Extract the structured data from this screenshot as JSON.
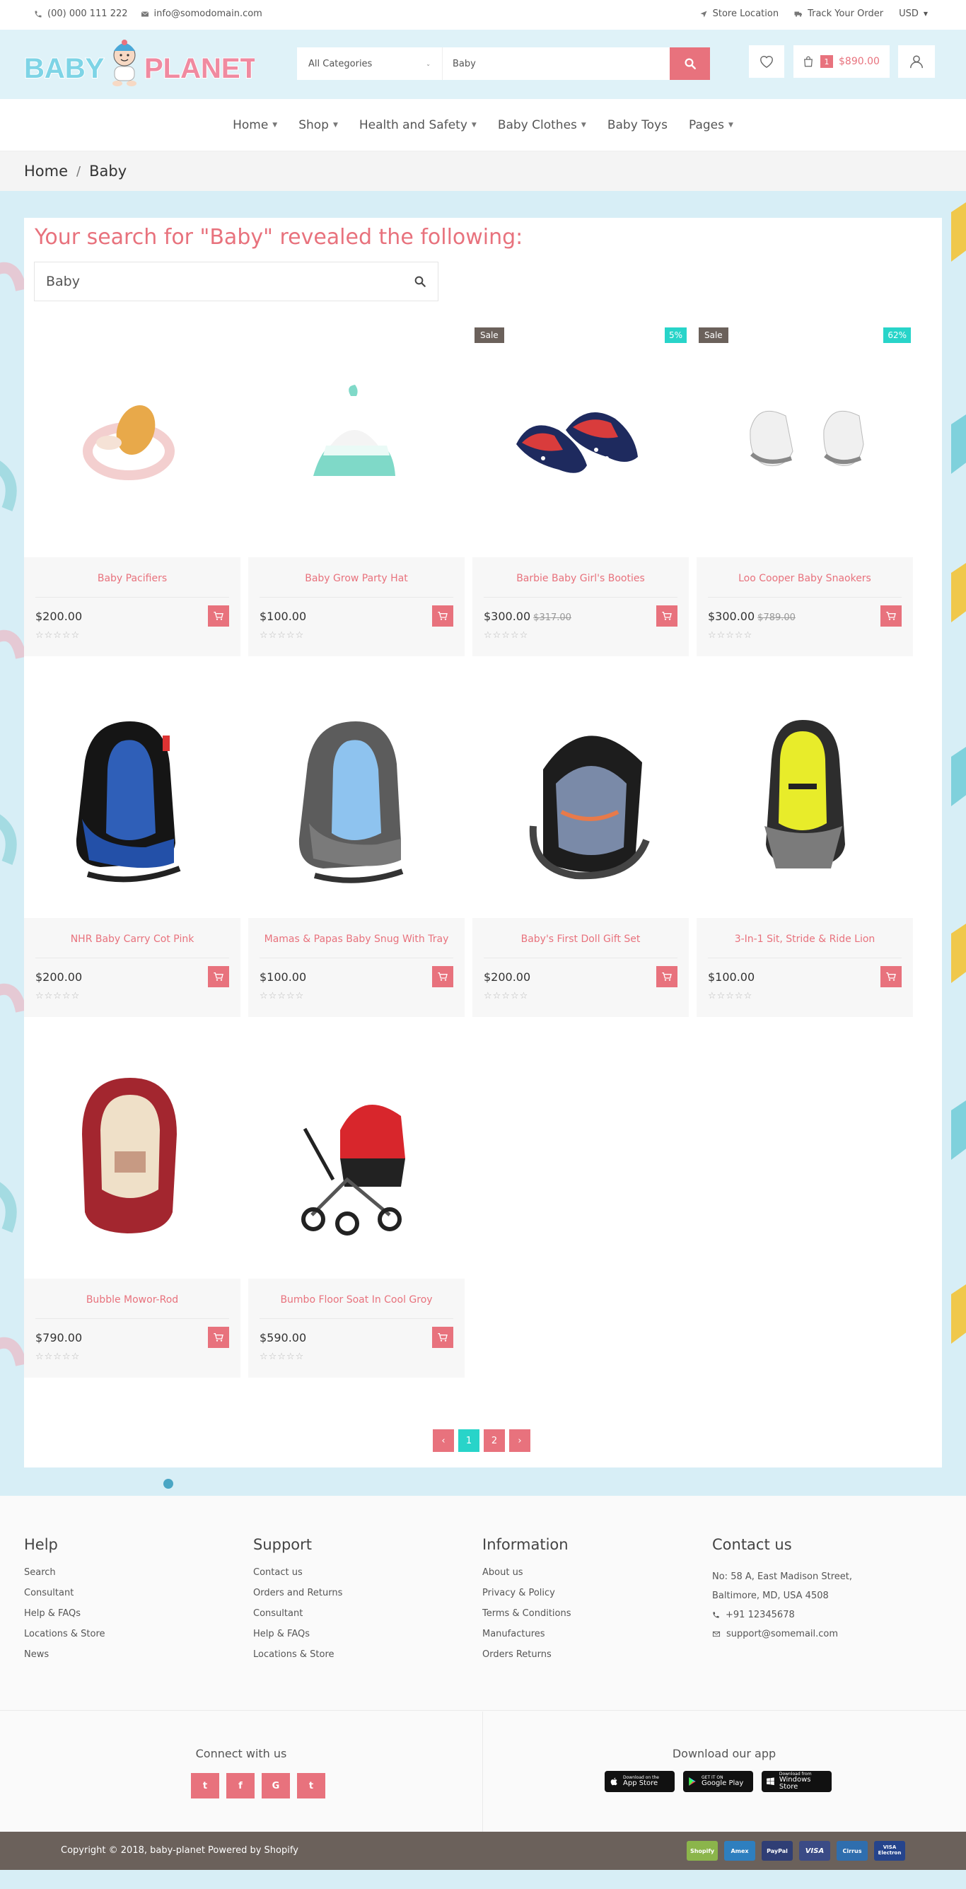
{
  "topbar": {
    "phone": "(00) 000 111 222",
    "email": "info@somodomain.com",
    "store_location": "Store Location",
    "track_order": "Track Your Order",
    "currency": "USD"
  },
  "header": {
    "logo_text": "BABY PLANET",
    "category_select": "All Categories",
    "search_value": "Baby",
    "cart_count": "1",
    "cart_total": "$890.00"
  },
  "nav": {
    "items": [
      {
        "label": "Home",
        "dropdown": true
      },
      {
        "label": "Shop",
        "dropdown": true
      },
      {
        "label": "Health and Safety",
        "dropdown": true
      },
      {
        "label": "Baby Clothes",
        "dropdown": true
      },
      {
        "label": "Baby Toys",
        "dropdown": false
      },
      {
        "label": "Pages",
        "dropdown": true
      }
    ]
  },
  "breadcrumb": {
    "home": "Home",
    "separator": "/",
    "current": "Baby"
  },
  "results": {
    "title": "Your search for \"Baby\" revealed the following:",
    "search_value": "Baby"
  },
  "products": [
    {
      "name": "Baby Pacifiers",
      "price": "$200.00",
      "old_price": "",
      "sale": "",
      "discount": "",
      "image": "pacifier"
    },
    {
      "name": "Baby Grow Party Hat",
      "price": "$100.00",
      "old_price": "",
      "sale": "",
      "discount": "",
      "image": "hat"
    },
    {
      "name": "Barbie Baby Girl's Booties",
      "price": "$300.00",
      "old_price": "$317.00",
      "sale": "Sale",
      "discount": "5%",
      "image": "booties"
    },
    {
      "name": "Loo Cooper Baby Snaokers",
      "price": "$300.00",
      "old_price": "$789.00",
      "sale": "Sale",
      "discount": "62%",
      "image": "sneakers"
    },
    {
      "name": "NHR Baby Carry Cot Pink",
      "price": "$200.00",
      "old_price": "",
      "sale": "",
      "discount": "",
      "image": "carseat-blue"
    },
    {
      "name": "Mamas & Papas Baby Snug With Tray",
      "price": "$100.00",
      "old_price": "",
      "sale": "",
      "discount": "",
      "image": "carseat-lightblue"
    },
    {
      "name": "Baby's First Doll Gift Set",
      "price": "$200.00",
      "old_price": "",
      "sale": "",
      "discount": "",
      "image": "carrier-grey"
    },
    {
      "name": "3-In-1 Sit, Stride & Ride Lion",
      "price": "$100.00",
      "old_price": "",
      "sale": "",
      "discount": "",
      "image": "carseat-yellow"
    },
    {
      "name": "Bubble Mowor-Rod",
      "price": "$790.00",
      "old_price": "",
      "sale": "",
      "discount": "",
      "image": "carseat-red"
    },
    {
      "name": "Bumbo Floor Soat In Cool Groy",
      "price": "$590.00",
      "old_price": "",
      "sale": "",
      "discount": "",
      "image": "stroller"
    }
  ],
  "pagination": {
    "prev": "‹",
    "pages": [
      "1",
      "2"
    ],
    "active": "1",
    "next": "›"
  },
  "footer": {
    "help": {
      "title": "Help",
      "links": [
        "Search",
        "Consultant",
        "Help & FAQs",
        "Locations & Store",
        "News"
      ]
    },
    "support": {
      "title": "Support",
      "links": [
        "Contact us",
        "Orders and Returns",
        "Consultant",
        "Help & FAQs",
        "Locations & Store"
      ]
    },
    "information": {
      "title": "Information",
      "links": [
        "About us",
        "Privacy & Policy",
        "Terms & Conditions",
        "Manufactures",
        "Orders Returns"
      ]
    },
    "contact": {
      "title": "Contact us",
      "address_line1": "No: 58 A, East Madison Street,",
      "address_line2": "Baltimore, MD, USA 4508",
      "phone": "+91 12345678",
      "email": "support@somemail.com"
    },
    "connect_title": "Connect with us",
    "social": [
      "t",
      "f",
      "G",
      "t"
    ],
    "download_title": "Download our app",
    "apps": [
      {
        "small": "Download on the",
        "big": "App Store"
      },
      {
        "small": "GET IT ON",
        "big": "Google Play"
      },
      {
        "small": "Download from",
        "big": "Windows Store"
      }
    ],
    "copyright": "Copyright © 2018, baby-planet Powered by Shopify",
    "payments": [
      "Shopify",
      "Amex",
      "PayPal",
      "VISA",
      "Cirrus",
      "VISA Electron"
    ]
  },
  "colors": {
    "accent": "#e8727d",
    "teal": "#28d4c9",
    "light_blue": "#dff2f8",
    "dark": "#6b615b"
  }
}
